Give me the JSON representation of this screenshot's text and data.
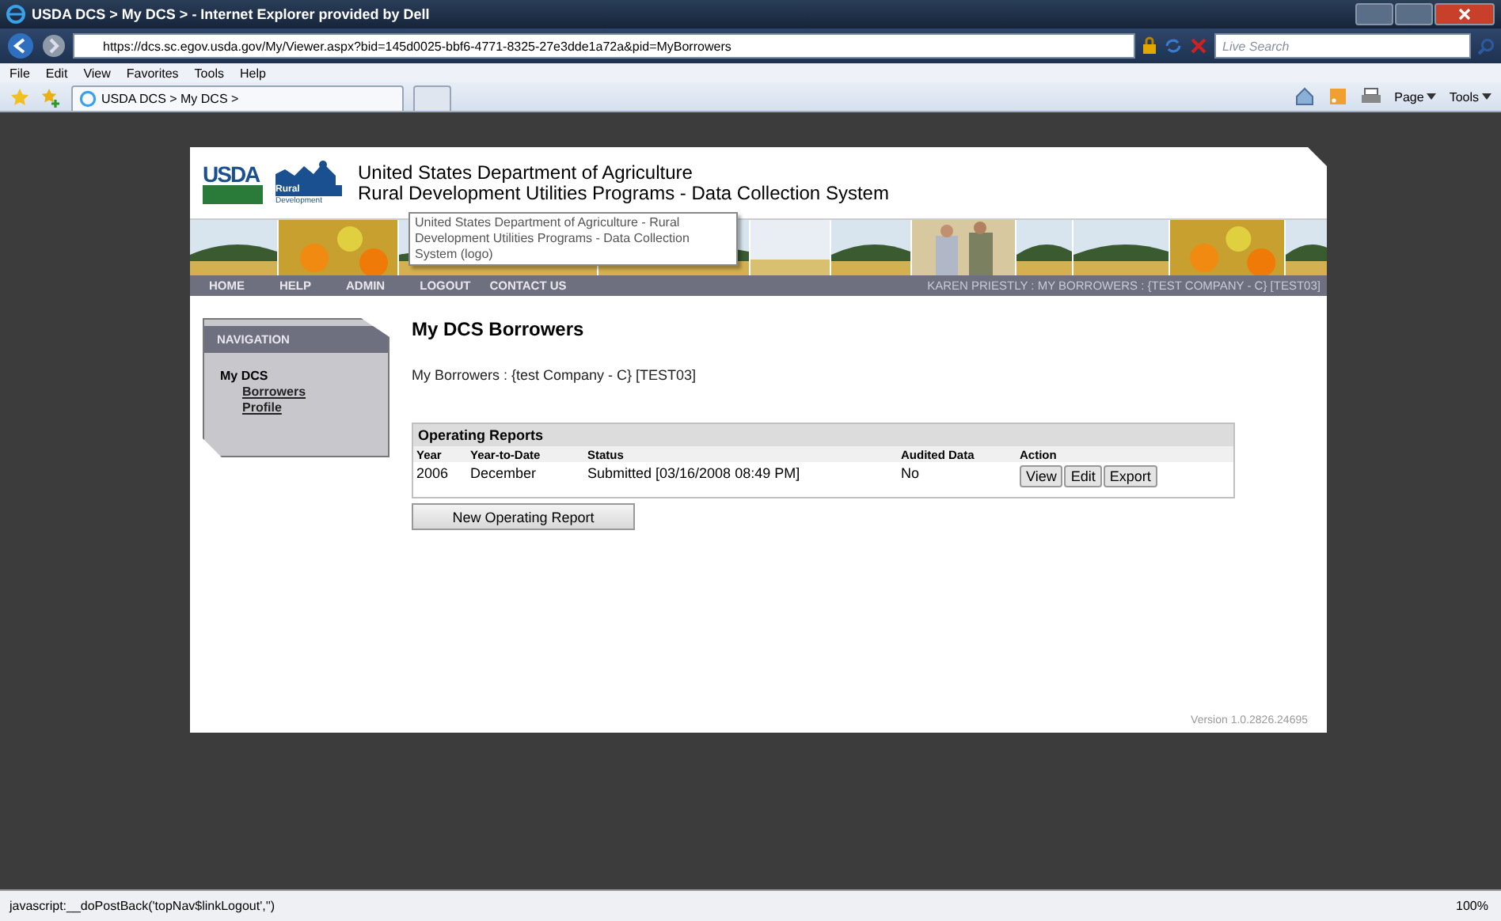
{
  "browser": {
    "title": "USDA DCS > My DCS > - Internet Explorer provided by Dell",
    "address": "https://dcs.sc.egov.usda.gov/My/Viewer.aspx?bid=145d0025-bbf6-4771-8325-27e3dde1a72a&pid=MyBorrowers",
    "search": {
      "placeholder": "Live Search"
    },
    "menu": [
      "File",
      "Edit",
      "View",
      "Favorites",
      "Tools",
      "Help"
    ],
    "tabs": [
      {
        "label": "USDA DCS > My DCS >",
        "selected": true
      },
      {
        "selected": false
      }
    ],
    "commands": [
      "Page",
      "Tools"
    ],
    "status_text": "javascript:__doPostBack('topNav$linkLogout','')",
    "zoom": "100%"
  },
  "page": {
    "logo": {
      "usda": "USDA",
      "rd_top": "Rural",
      "rd_bottom": "Development"
    },
    "header_lines": [
      "United States Department of Agriculture",
      "Rural Development Utilities Programs - Data Collection System"
    ],
    "tooltip": "United States Department of Agriculture - Rural Development Utilities Programs - Data Collection System (logo)",
    "top_nav": [
      "HOME",
      "HELP",
      "ADMIN",
      "LOGOUT",
      "CONTACT US"
    ],
    "trail": "KAREN PRIESTLY : MY BORROWERS : {TEST COMPANY - C} [TEST03]",
    "navigation": {
      "title": "NAVIGATION",
      "items": [
        {
          "label": "My DCS",
          "children": [
            {
              "label": "Borrowers"
            },
            {
              "label": "Profile"
            }
          ]
        }
      ]
    },
    "heading": "My DCS Borrowers",
    "borrower": "My Borrowers : {test Company - C} [TEST03]",
    "table": {
      "title": "Operating Reports",
      "columns": [
        "Year",
        "Year-to-Date",
        "Status",
        "Audited Data",
        "Action"
      ],
      "rows": [
        {
          "cells": [
            "2006",
            "December",
            "Submitted [03/16/2008 08:49 PM]",
            "No"
          ],
          "actions": [
            "View",
            "Edit",
            "Export"
          ]
        }
      ]
    },
    "new_button": "New Operating Report",
    "version": "Version 1.0.2826.24695"
  }
}
